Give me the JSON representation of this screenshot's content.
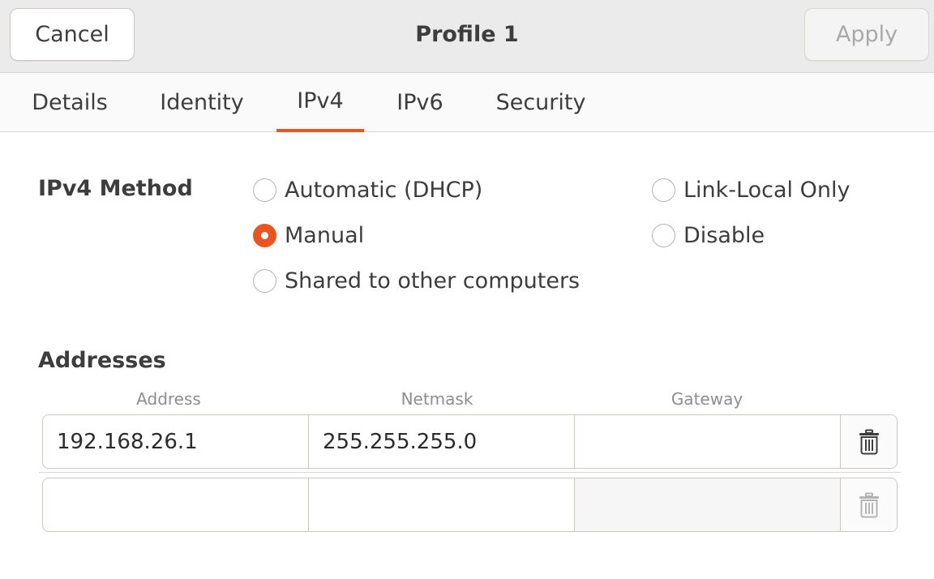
{
  "header": {
    "cancel_label": "Cancel",
    "title": "Profile 1",
    "apply_label": "Apply"
  },
  "tabs": [
    {
      "label": "Details",
      "active": false
    },
    {
      "label": "Identity",
      "active": false
    },
    {
      "label": "IPv4",
      "active": true
    },
    {
      "label": "IPv6",
      "active": false
    },
    {
      "label": "Security",
      "active": false
    }
  ],
  "ipv4": {
    "method_label": "IPv4 Method",
    "options": [
      {
        "label": "Automatic (DHCP)",
        "checked": false
      },
      {
        "label": "Manual",
        "checked": true
      },
      {
        "label": "Shared to other computers",
        "checked": false
      },
      {
        "label": "Link-Local Only",
        "checked": false
      },
      {
        "label": "Disable",
        "checked": false
      }
    ]
  },
  "addresses": {
    "section_label": "Addresses",
    "columns": [
      "Address",
      "Netmask",
      "Gateway"
    ],
    "rows": [
      {
        "address": "192.168.26.1",
        "netmask": "255.255.255.0",
        "gateway": ""
      },
      {
        "address": "",
        "netmask": "",
        "gateway": ""
      }
    ]
  },
  "colors": {
    "accent": "#e95420",
    "text": "#3d3d3d",
    "muted": "#8d8d8d"
  },
  "icons": {
    "delete": "trash-icon"
  }
}
